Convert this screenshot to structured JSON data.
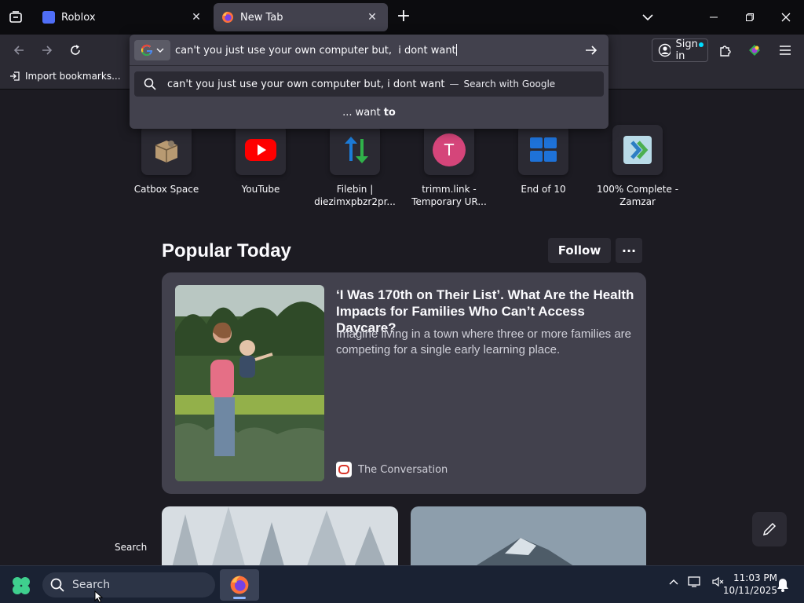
{
  "tabs": [
    {
      "title": "Roblox",
      "active": false,
      "favicon_color": "#4f6ef7"
    },
    {
      "title": "New Tab",
      "active": true,
      "favicon": "firefox-icon"
    }
  ],
  "window_controls": [
    "minimize",
    "maximize",
    "close"
  ],
  "toolbar": {
    "sign_in_label": "Sign in",
    "import_bookmarks_label": "Import bookmarks..."
  },
  "urlbar": {
    "value": "can't you just use your own computer but,  i dont want",
    "engine": "Google"
  },
  "suggestions": [
    {
      "query": "can't you just use your own computer but, i dont want",
      "separator": "—",
      "action": "Search with Google"
    },
    {
      "prefix": "... want ",
      "bold": "to"
    }
  ],
  "shortcuts": [
    {
      "label": "Catbox Space",
      "icon": "box-icon"
    },
    {
      "label": "YouTube",
      "icon": "youtube-icon"
    },
    {
      "label": "Filebin | diezimxpbzr2pr...",
      "icon": "arrows-updown-icon"
    },
    {
      "label": "trimm.link - Temporary UR...",
      "icon": "letter-t-icon",
      "letter": "T"
    },
    {
      "label": "End of 10",
      "icon": "windows-tiles-icon"
    },
    {
      "label": "100% Complete - Zamzar",
      "icon": "zamzar-icon"
    }
  ],
  "popular": {
    "title": "Popular Today",
    "follow_label": "Follow",
    "more_label": "···"
  },
  "story": {
    "headline": "‘I Was 170th on Their List’. What Are the Health Impacts for Families Who Can’t Access Daycare?",
    "excerpt": "Imagine living in a town where three or more families are competing for a single early learning place.",
    "source": "The Conversation"
  },
  "floating_search_label": "Search",
  "taskbar": {
    "search_placeholder": "Search",
    "time": "11:03 PM",
    "date": "10/11/2025"
  },
  "colors": {
    "accent": "#00ddff",
    "tab_bg": "#42414d",
    "page_bg": "#1c1b22",
    "card_bg": "#42414d",
    "taskbar_bg": "#1a2233"
  }
}
